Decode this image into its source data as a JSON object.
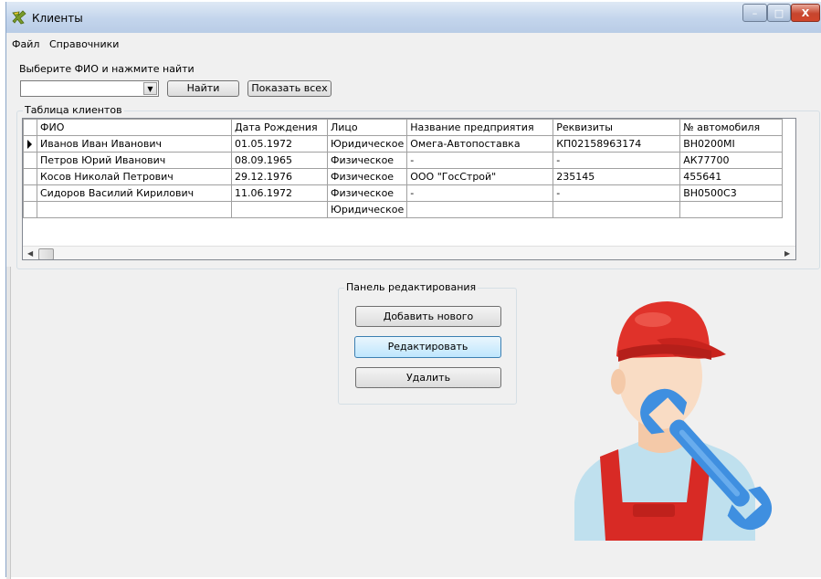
{
  "window": {
    "title": "Клиенты",
    "controls": {
      "minimize": "–",
      "maximize": "□",
      "close": "X"
    }
  },
  "menu": [
    "Файл",
    "Справочники"
  ],
  "search": {
    "prompt": "Выберите ФИО и нажмите найти",
    "combo_value": "",
    "find_button": "Найти",
    "show_all_button": "Показать всех"
  },
  "table": {
    "group_title": "Таблица клиентов",
    "columns": [
      "ФИО",
      "Дата Рождения",
      "Лицо",
      "Название предприятия",
      "Реквизиты",
      "№ автомобиля"
    ],
    "rows": [
      [
        "Иванов Иван Иванович",
        "01.05.1972",
        "Юридическое",
        "Омега-Автопоставка",
        "КП02158963174",
        "ВН0200МI"
      ],
      [
        "Петров Юрий Иванович",
        "08.09.1965",
        "Физическое",
        "-",
        "-",
        "АК77700"
      ],
      [
        "Косов Николай Петрович",
        "29.12.1976",
        "Физическое",
        "ООО \"ГосСтрой\"",
        "235145",
        "455641"
      ],
      [
        "Сидоров Василий Кирилович",
        "11.06.1972",
        "Физическое",
        "-",
        "-",
        "ВН0500С3"
      ],
      [
        "",
        "",
        "Юридическое",
        "",
        "",
        ""
      ]
    ],
    "selected_row": 0
  },
  "edit_panel": {
    "title": "Панель редактирования",
    "add_button": "Добавить нового",
    "edit_button": "Редактировать",
    "delete_button": "Удалить"
  },
  "colors": {
    "titlebar": "#c3d5ec",
    "window_bg": "#f0f0f0",
    "close_button": "#c7452e",
    "cap_red": "#e0322a",
    "wrench_blue": "#3f8fe0"
  },
  "icons": [
    "app-icon",
    "dropdown-arrow-icon",
    "row-selector-icon",
    "scroll-up-icon",
    "scroll-down-icon",
    "scroll-left-icon",
    "scroll-right-icon",
    "mechanic-illustration"
  ]
}
